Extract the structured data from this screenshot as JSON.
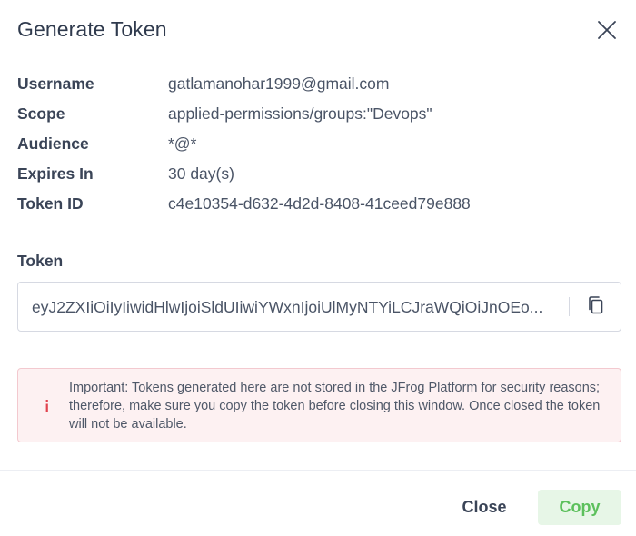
{
  "dialog": {
    "title": "Generate Token",
    "close_icon": "close-icon"
  },
  "details": [
    {
      "label": "Username",
      "value": "gatlamanohar1999@gmail.com"
    },
    {
      "label": "Scope",
      "value": "applied-permissions/groups:\"Devops\""
    },
    {
      "label": "Audience",
      "value": "*@*"
    },
    {
      "label": "Expires In",
      "value": "30 day(s)"
    },
    {
      "label": "Token ID",
      "value": "c4e10354-d632-4d2d-8408-41ceed79e888"
    }
  ],
  "token": {
    "label": "Token",
    "value": "eyJ2ZXIiOiIyIiwidHlwIjoiSldUIiwiYWxnIjoiUlMyNTYiLCJraWQiOiJnOEo...",
    "copy_icon": "copy-icon"
  },
  "alert": {
    "icon": "info-icon",
    "text": "Important: Tokens generated here are not stored in the JFrog Platform for security reasons; therefore, make sure you copy the token before closing this window. Once closed the token will not be available."
  },
  "footer": {
    "close_label": "Close",
    "copy_label": "Copy"
  },
  "colors": {
    "alert_background": "#fdf1f2",
    "alert_border": "#f3c9cf",
    "alert_icon": "#e0434f",
    "copy_button_background": "#e7f6e7",
    "copy_button_text": "#5cc05c"
  }
}
